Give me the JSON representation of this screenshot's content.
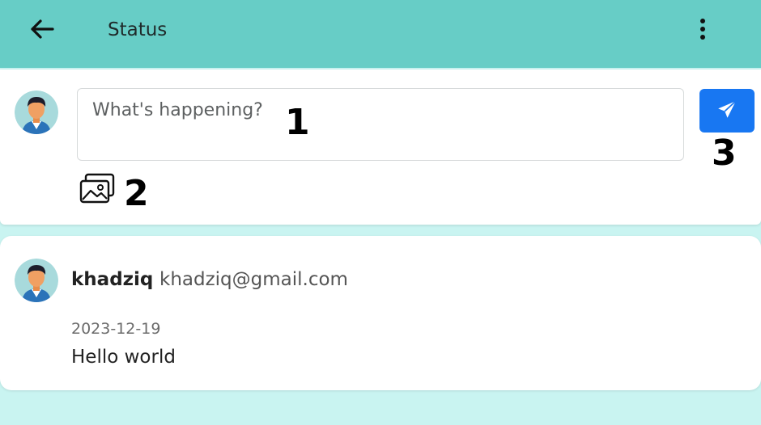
{
  "appbar": {
    "title": "Status",
    "back_icon": "arrow-left-icon",
    "menu_icon": "more-vertical-icon"
  },
  "compose": {
    "avatar_icon": "user-avatar-icon",
    "placeholder": "What's happening?",
    "send_icon": "paper-plane-icon",
    "image_icon": "images-icon",
    "markers": [
      "1",
      "2",
      "3"
    ]
  },
  "post": {
    "avatar_icon": "user-avatar-icon",
    "name": "khadziq",
    "email": "khadziq@gmail.com",
    "date": "2023-12-19",
    "text": "Hello world"
  },
  "colors": {
    "appbar": "#67cdc6",
    "background": "#c9f4f1",
    "send_button": "#1877f2"
  }
}
